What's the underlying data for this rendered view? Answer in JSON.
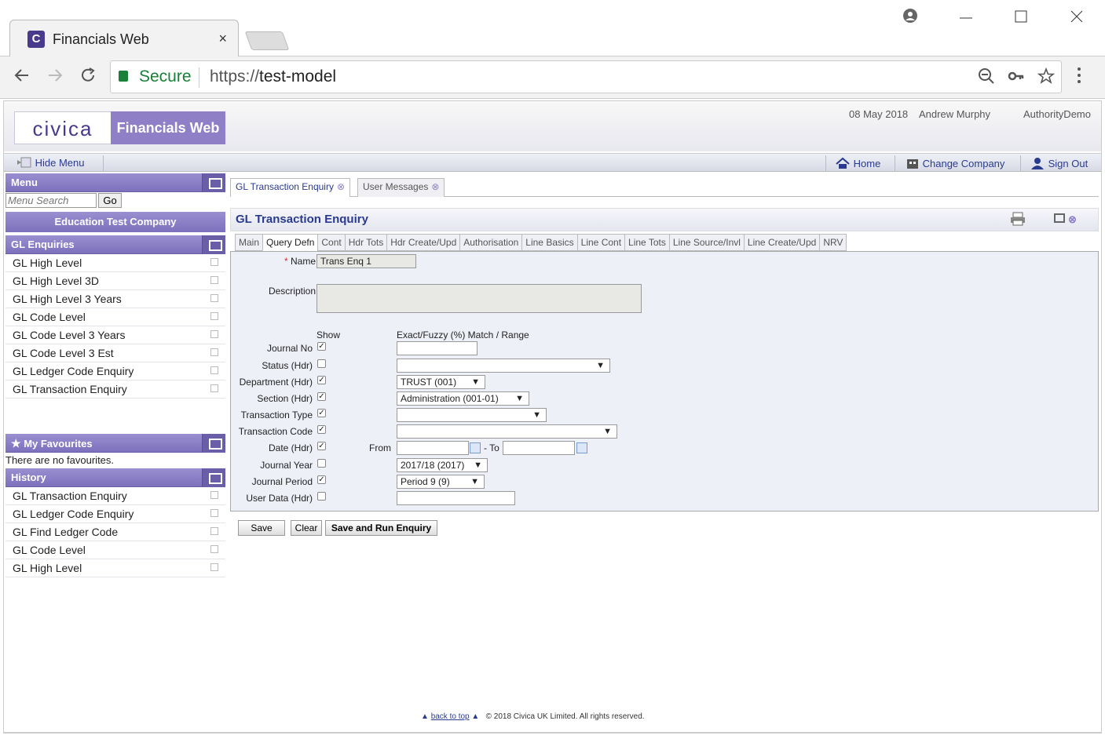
{
  "browser": {
    "tab_title": "Financials Web",
    "tab_close": "×",
    "secure_label": "Secure",
    "url_protocol": "https://",
    "url_host": "test-model"
  },
  "header": {
    "logo_text": "civica",
    "product_name": "Financials Web",
    "date": "08 May 2018",
    "user": "Andrew Murphy",
    "authority": "AuthorityDemo"
  },
  "topbar": {
    "hide_menu": "Hide Menu",
    "home": "Home",
    "change_company": "Change Company",
    "sign_out": "Sign Out"
  },
  "sidebar": {
    "menu_title": "Menu",
    "search_placeholder": "Menu Search",
    "go_label": "Go",
    "company": "Education Test Company",
    "section_title": "GL Enquiries",
    "items": [
      {
        "label": "GL High Level"
      },
      {
        "label": "GL High Level 3D"
      },
      {
        "label": "GL High Level 3 Years"
      },
      {
        "label": "GL Code Level"
      },
      {
        "label": "GL Code Level 3 Years"
      },
      {
        "label": "GL Code Level 3 Est"
      },
      {
        "label": "GL Ledger Code Enquiry"
      },
      {
        "label": "GL Transaction Enquiry"
      }
    ],
    "favourites_title": "My Favourites",
    "no_favourites": "There are no favourites.",
    "history_title": "History",
    "history": [
      {
        "label": "GL Transaction Enquiry"
      },
      {
        "label": "GL Ledger Code Enquiry"
      },
      {
        "label": "GL Find Ledger Code"
      },
      {
        "label": "GL Code Level"
      },
      {
        "label": "GL High Level"
      }
    ]
  },
  "page_tabs": [
    {
      "label": "GL Transaction Enquiry"
    },
    {
      "label": "User Messages"
    }
  ],
  "page_title": "GL Transaction Enquiry",
  "subtabs": [
    {
      "label": "Main"
    },
    {
      "label": "Query Defn"
    },
    {
      "label": "Cont"
    },
    {
      "label": "Hdr Tots"
    },
    {
      "label": "Hdr Create/Upd"
    },
    {
      "label": "Authorisation"
    },
    {
      "label": "Line Basics"
    },
    {
      "label": "Line Cont"
    },
    {
      "label": "Line Tots"
    },
    {
      "label": "Line Source/Invl"
    },
    {
      "label": "Line Create/Upd"
    },
    {
      "label": "NRV"
    }
  ],
  "active_subtab": "Query Defn",
  "form": {
    "required_mark": "*",
    "name_label": "Name",
    "name_value": "Trans Enq 1",
    "description_label": "Description",
    "description_value": "",
    "show_header": "Show",
    "match_header": "Exact/Fuzzy (%) Match / Range",
    "rows": [
      {
        "label": "Journal No",
        "checked": true
      },
      {
        "label": "Status (Hdr)",
        "checked": false
      },
      {
        "label": "Department (Hdr)",
        "checked": true
      },
      {
        "label": "Section (Hdr)",
        "checked": true
      },
      {
        "label": "Transaction Type",
        "checked": true
      },
      {
        "label": "Transaction Code",
        "checked": true
      },
      {
        "label": "Date (Hdr)",
        "checked": true
      },
      {
        "label": "Journal Year",
        "checked": false
      },
      {
        "label": "Journal Period",
        "checked": true
      },
      {
        "label": "User Data (Hdr)",
        "checked": false
      }
    ],
    "department_value": "TRUST (001)",
    "section_value": "Administration (001-01)",
    "journal_year_value": "2017/18 (2017)",
    "journal_period_value": "Period 9 (9)",
    "from_label": "From",
    "to_label": "- To"
  },
  "buttons": {
    "save": "Save",
    "clear": "Clear",
    "save_run": "Save and Run Enquiry"
  },
  "footer": {
    "back_to_top": "back to top",
    "copyright": "© 2018 Civica UK Limited. All rights reserved."
  }
}
